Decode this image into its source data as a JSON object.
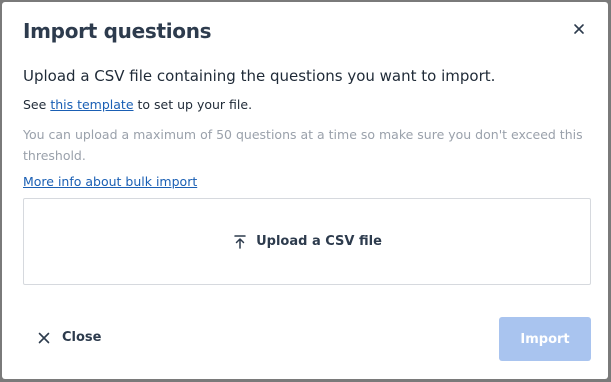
{
  "dialog": {
    "title": "Import questions",
    "intro": "Upload a CSV file containing the questions you want to import.",
    "see_prefix": "See",
    "template_link": "this template",
    "see_suffix": "to set up your file.",
    "hint": "You can upload a maximum of 50 questions at a time so make sure you don't exceed this threshold.",
    "more_info_link": "More info about bulk import",
    "upload_label": "Upload a CSV file",
    "close_label": "Close",
    "import_label": "Import"
  },
  "icons": {
    "header_close": "close-icon",
    "upload": "upload-icon",
    "footer_close": "close-icon"
  },
  "colors": {
    "link": "#1a5fb4",
    "import_disabled": "#a9c4ef",
    "title": "#2d3b4d",
    "hint": "#9aa1ab"
  }
}
